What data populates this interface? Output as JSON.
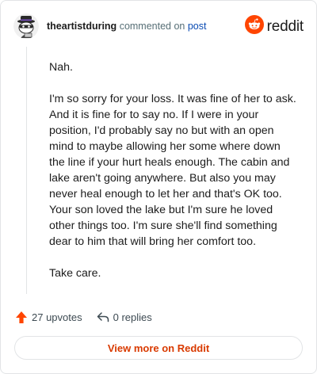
{
  "header": {
    "username": "theartistduring",
    "action_text": "commented on",
    "post_link": "post",
    "brand": "reddit"
  },
  "comment": {
    "paragraphs": [
      "Nah.",
      "I'm so sorry for your loss. It was fine of her to ask. And it is fine for to say no. If I were in your position, I'd probably say no but with an open mind to maybe allowing her some where down the line if your hurt heals enough. The cabin and lake aren't going anywhere. But also you may never heal enough to let her and that's OK too. Your son loved the lake but I'm sure he loved other things too. I'm sure she'll find something dear to him that will bring her comfort too.",
      "Take care."
    ]
  },
  "actions": {
    "upvotes": "27 upvotes",
    "replies": "0 replies"
  },
  "footer": {
    "view_more": "View more on Reddit"
  },
  "colors": {
    "brand_orange": "#ff4500",
    "upvote_orange": "#ff4500",
    "link_blue": "#0a4bb3",
    "view_more_text": "#d93a00"
  },
  "icons": {
    "avatar": "snoo-avatar-icon",
    "brand_logo": "reddit-logo-icon",
    "upvote": "upvote-arrow-icon",
    "reply": "reply-arrow-icon"
  }
}
